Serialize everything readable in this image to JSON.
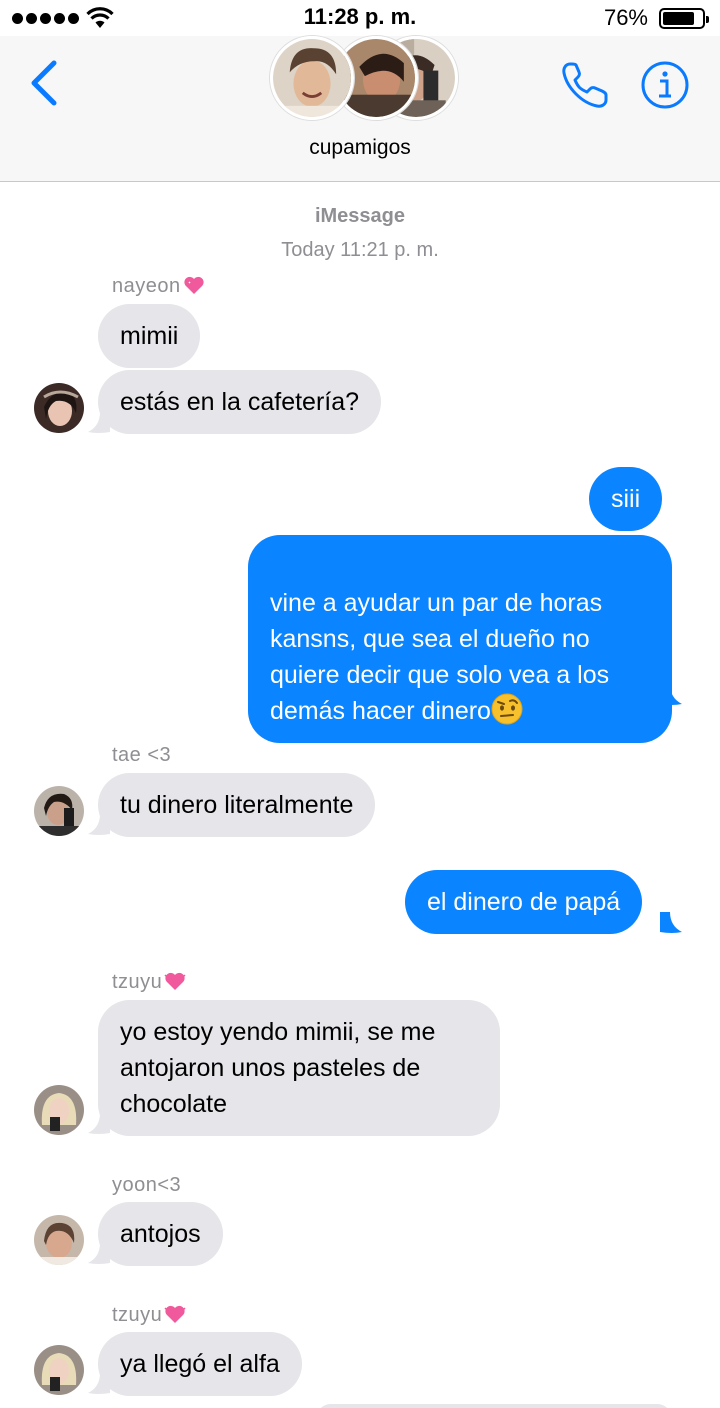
{
  "status_bar": {
    "time": "11:28 p. m.",
    "battery": "76%",
    "battery_level": 0.76,
    "signal_bars": 5
  },
  "header": {
    "back_icon": "chevron-left-icon",
    "group_name": "cupamigos",
    "call_icon": "phone-icon",
    "info_icon": "info-icon",
    "accent": "#0a7aff"
  },
  "conversation": {
    "service": "iMessage",
    "timestamp": "Today 11:21 p. m."
  },
  "messages": [
    {
      "sender": "nayeon",
      "sender_emoji": "sparkling-heart",
      "text": "mimii"
    },
    {
      "text": "estás en la cafetería?"
    },
    {
      "text": "siii"
    },
    {
      "text": "vine a ayudar un par de horas kansns, que sea el dueño no quiere decir que solo vea a los demás hacer dinero",
      "emoji": "face-with-raised-eyebrow"
    },
    {
      "sender": "tae <3",
      "text": "tu dinero literalmente"
    },
    {
      "text": "el dinero de papá"
    },
    {
      "sender": "tzuyu",
      "sender_emoji": "beating-heart",
      "text": "yo estoy yendo mimii, se me antojaron unos pasteles de chocolate"
    },
    {
      "sender": "yoon<3",
      "text": "antojos"
    },
    {
      "sender": "tzuyu",
      "sender_emoji": "beating-heart",
      "text": "ya llegó el alfa"
    }
  ],
  "colors": {
    "incoming_bubble": "#e5e5ea",
    "outgoing_bubble": "#0a84ff",
    "meta_text": "#8e8e93"
  }
}
